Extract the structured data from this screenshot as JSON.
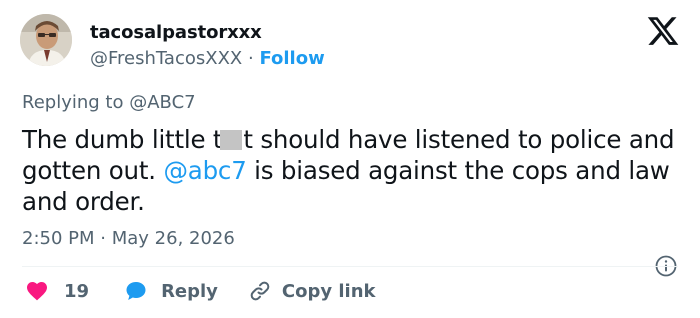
{
  "author": {
    "display_name": "tacosalpastorxxx",
    "handle": "@FreshTacosXXX",
    "separator": "·",
    "follow_label": "Follow"
  },
  "reply_to": {
    "prefix": "Replying to",
    "target": "@ABC7"
  },
  "tweet": {
    "text_before_censor": "The dumb little t",
    "text_after_censor": "t should have listened to police and gotten out. ",
    "mention": "@abc7",
    "text_after_mention": " is biased against the cops and law and order."
  },
  "timestamp": {
    "time": "2:50 PM",
    "separator": "·",
    "date": "May 26, 2026"
  },
  "actions": {
    "like_count": "19",
    "reply_label": "Reply",
    "copy_link_label": "Copy link"
  },
  "icons": {
    "brand": "x-logo-icon",
    "like": "heart-icon",
    "reply": "speech-bubble-icon",
    "copy": "link-icon",
    "info": "info-icon"
  },
  "colors": {
    "accent": "#1d9bf0",
    "like": "#f91880",
    "secondary_text": "#536471",
    "primary_text": "#0f1419"
  }
}
